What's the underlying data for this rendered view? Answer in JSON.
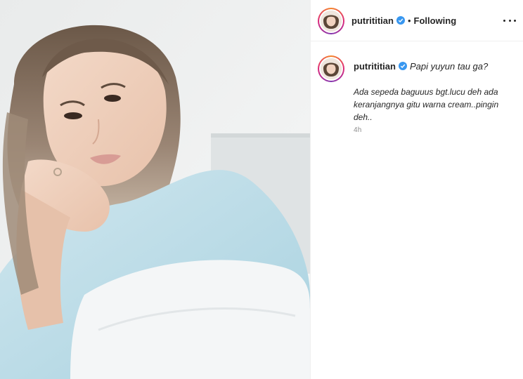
{
  "post": {
    "image_alt": "Young woman resting chin on hands, wearing a light blue shirt",
    "author": {
      "username": "putrititian",
      "verified": true
    },
    "follow_status": "Following",
    "separator": "•",
    "caption": {
      "headline": "Papi yuyun tau ga?",
      "body": "Ada sepeda baguuus bgt.lucu deh ada keranjangnya gitu warna cream..pingin deh.."
    },
    "time_ago": "4h"
  },
  "icons": {
    "verified": "verified-badge-icon",
    "more": "more-options-icon"
  },
  "colors": {
    "verified_blue": "#3897f0",
    "text": "#262626",
    "muted": "#8e8e8e"
  }
}
